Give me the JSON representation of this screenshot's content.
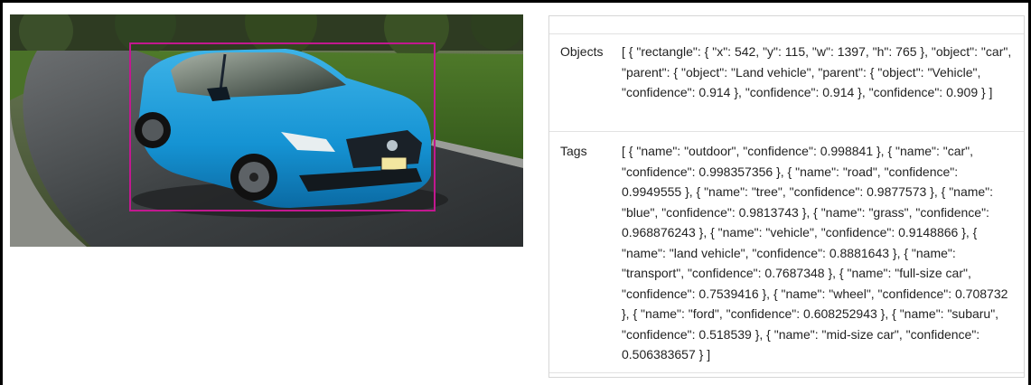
{
  "image": {
    "description_icon": "car-photo",
    "bbox_color": "#c2188f"
  },
  "results": {
    "objects": {
      "label": "Objects",
      "value": "[ { \"rectangle\": { \"x\": 542, \"y\": 115, \"w\": 1397, \"h\": 765 }, \"object\": \"car\", \"parent\": { \"object\": \"Land vehicle\", \"parent\": { \"object\": \"Vehicle\", \"confidence\": 0.914 }, \"confidence\": 0.914 }, \"confidence\": 0.909 } ]"
    },
    "tags": {
      "label": "Tags",
      "value": "[ { \"name\": \"outdoor\", \"confidence\": 0.998841 }, { \"name\": \"car\", \"confidence\": 0.998357356 }, { \"name\": \"road\", \"confidence\": 0.9949555 }, { \"name\": \"tree\", \"confidence\": 0.9877573 }, { \"name\": \"blue\", \"confidence\": 0.9813743 }, { \"name\": \"grass\", \"confidence\": 0.968876243 }, { \"name\": \"vehicle\", \"confidence\": 0.9148866 }, { \"name\": \"land vehicle\", \"confidence\": 0.8881643 }, { \"name\": \"transport\", \"confidence\": 0.7687348 }, { \"name\": \"full-size car\", \"confidence\": 0.7539416 }, { \"name\": \"wheel\", \"confidence\": 0.708732 }, { \"name\": \"ford\", \"confidence\": 0.608252943 }, { \"name\": \"subaru\", \"confidence\": 0.518539 }, { \"name\": \"mid-size car\", \"confidence\": 0.506383657 } ]"
    }
  }
}
